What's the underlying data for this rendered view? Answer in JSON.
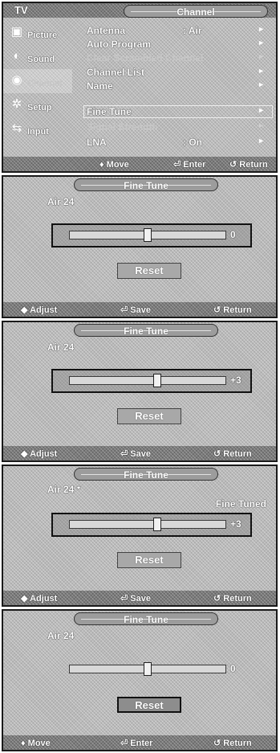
{
  "screen1": {
    "tv_label": "TV",
    "title": "Channel",
    "sidebar": [
      {
        "label": "Picture",
        "icon": "picture-icon"
      },
      {
        "label": "Sound",
        "icon": "sound-icon"
      },
      {
        "label": "Channel",
        "icon": "channel-icon"
      },
      {
        "label": "Setup",
        "icon": "setup-icon"
      },
      {
        "label": "Input",
        "icon": "input-icon"
      }
    ],
    "menu": [
      {
        "label": "Antenna",
        "value": ": Air",
        "arrow": "►"
      },
      {
        "label": "Auto Program",
        "value": "",
        "arrow": "►"
      },
      {
        "label": "Clear Scrambled Channel",
        "value": "",
        "arrow": "►"
      },
      {
        "label": "Channel List",
        "value": "",
        "arrow": "►"
      },
      {
        "label": "Name",
        "value": "",
        "arrow": "►"
      },
      {
        "label": "Fine Tune",
        "value": "",
        "arrow": "►"
      },
      {
        "label": "Signal Strength",
        "value": "",
        "arrow": "►"
      },
      {
        "label": "LNA",
        "value": ": On",
        "arrow": "►"
      }
    ],
    "footer": {
      "move": "♦ Move",
      "enter": "⏎ Enter",
      "return": "↺ Return"
    }
  },
  "fine_tune_screens": [
    {
      "title": "Fine Tune",
      "channel": "Air 24",
      "status": "",
      "slider_value": "0",
      "slider_level": 0.5,
      "reset": "Reset",
      "footer": {
        "left": "◆ Adjust",
        "mid": "⏎ Save",
        "right": "↺ Return"
      }
    },
    {
      "title": "Fine Tune",
      "channel": "Air 24",
      "status": "",
      "slider_value": "+3",
      "slider_level": 0.56,
      "reset": "Reset",
      "footer": {
        "left": "◆ Adjust",
        "mid": "⏎ Save",
        "right": "↺ Return"
      }
    },
    {
      "title": "Fine Tune",
      "channel": "Air 24 *",
      "status": "Fine Tuned",
      "slider_value": "+3",
      "slider_level": 0.56,
      "reset": "Reset",
      "footer": {
        "left": "◆ Adjust",
        "mid": "⏎ Save",
        "right": "↺ Return"
      }
    },
    {
      "title": "Fine Tune",
      "channel": "Air 24",
      "status": "",
      "slider_value": "0",
      "slider_level": 0.5,
      "reset": "Reset",
      "footer": {
        "left": "♦ Move",
        "mid": "⏎ Enter",
        "right": "↺ Return"
      }
    }
  ]
}
